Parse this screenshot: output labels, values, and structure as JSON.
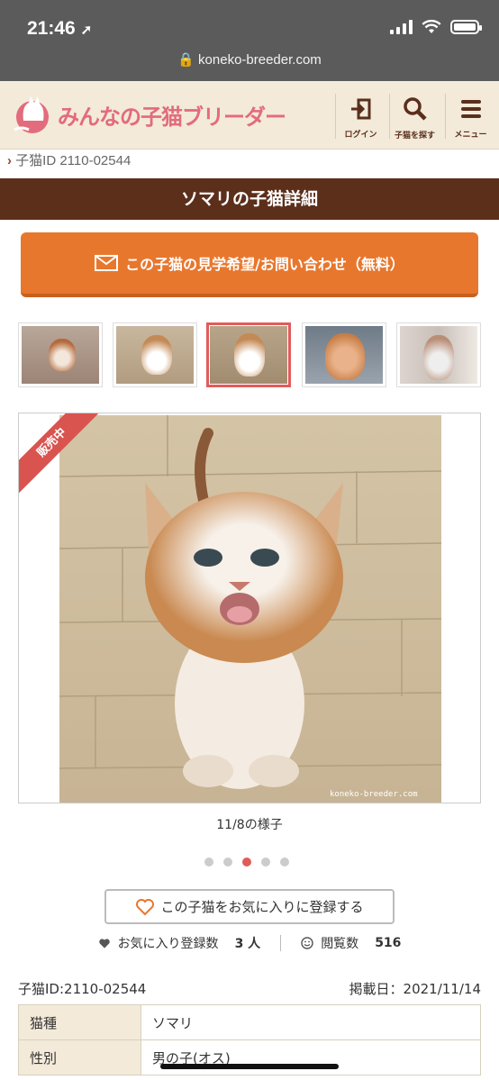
{
  "status": {
    "time": "21:46"
  },
  "browser": {
    "url": "koneko-breeder.com"
  },
  "header": {
    "logo_text": "みんなの子猫ブリーダー",
    "login_label": "ログイン",
    "search_label": "子猫を探す",
    "menu_label": "メニュー"
  },
  "breadcrumb": {
    "arrow": "›",
    "text": "子猫ID 2110-02544"
  },
  "page_title": "ソマリの子猫詳細",
  "cta": {
    "label": "この子猫の見学希望/お問い合わせ（無料）"
  },
  "gallery": {
    "ribbon": "販売中",
    "watermark": "koneko-breeder.com",
    "caption": "11/8の様子",
    "active_index": 2,
    "count": 5
  },
  "favorite": {
    "button_label": "この子猫をお気に入りに登録する",
    "fav_count_label": "お気に入り登録数",
    "fav_count": "3 人",
    "views_label": "閲覧数",
    "views": "516"
  },
  "info": {
    "kitten_id": "子猫ID:2110-02544",
    "posted": "掲載日：2021/11/14",
    "rows": [
      {
        "key": "猫種",
        "value": "ソマリ"
      },
      {
        "key": "性別",
        "value": "男の子(オス)"
      }
    ]
  },
  "colors": {
    "brand_pink": "#e26b7c",
    "title_brown": "#5c2f1b",
    "cta_orange": "#e8772e",
    "ribbon_red": "#d9534f"
  }
}
